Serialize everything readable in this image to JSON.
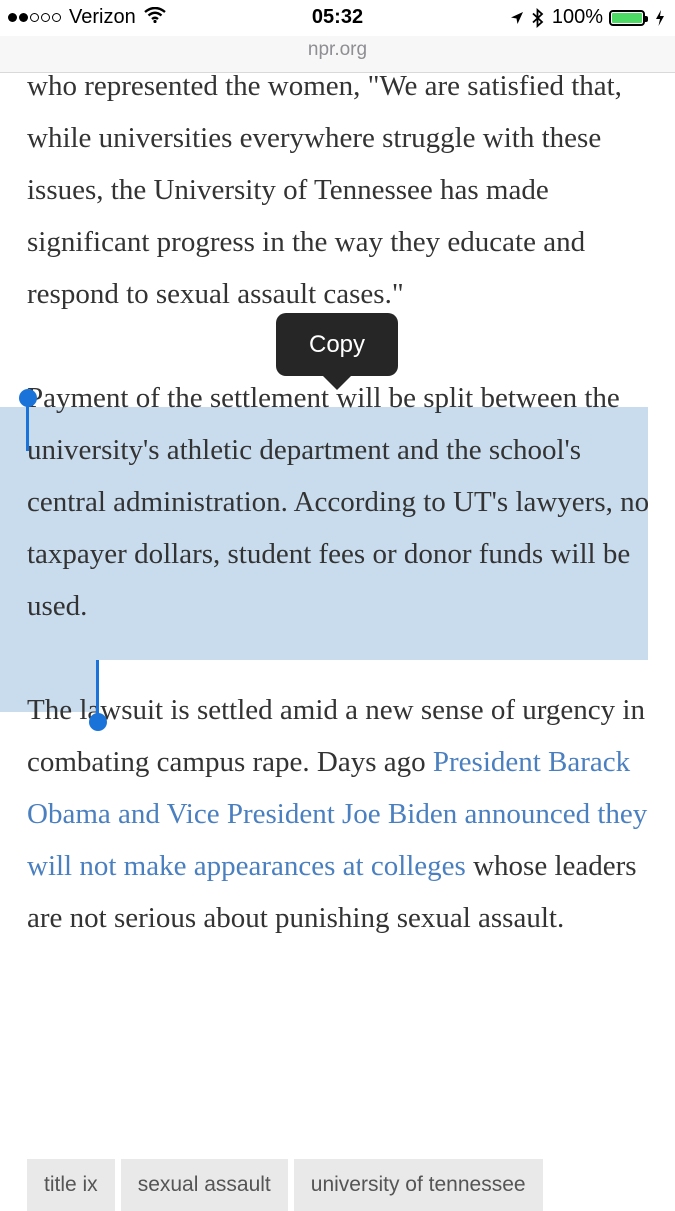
{
  "status": {
    "carrier": "Verizon",
    "time": "05:32",
    "battery": "100%"
  },
  "url": "npr.org",
  "callout": {
    "label": "Copy"
  },
  "article": {
    "p1": "who represented the women, \"We are satisfied that, while universities everywhere struggle with these issues, the University of Tennessee has made significant progress in the way they educate and respond to sexual assault cases.\"",
    "p2": "Payment of the settlement will be split between the university's athletic department and the school's central administration. According to UT's lawyers, no taxpayer dollars, student fees or donor funds will be used.",
    "p3_before": "The lawsuit is settled amid a new sense of urgency in combating campus rape. Days ago ",
    "p3_link": "President Barack Obama and Vice President Joe Biden announced they will not make appearances at colleges",
    "p3_after": " whose leaders are not serious about punishing sexual assault."
  },
  "tags": [
    "title ix",
    "sexual assault",
    "university of tennessee"
  ],
  "colors": {
    "selection": "#c9dcee",
    "handle": "#1a73d9",
    "link": "#4a7fc0",
    "battery": "#4cd964"
  },
  "icons": [
    "wifi-icon",
    "location-arrow-icon",
    "bluetooth-icon",
    "battery-icon",
    "charging-bolt-icon"
  ]
}
